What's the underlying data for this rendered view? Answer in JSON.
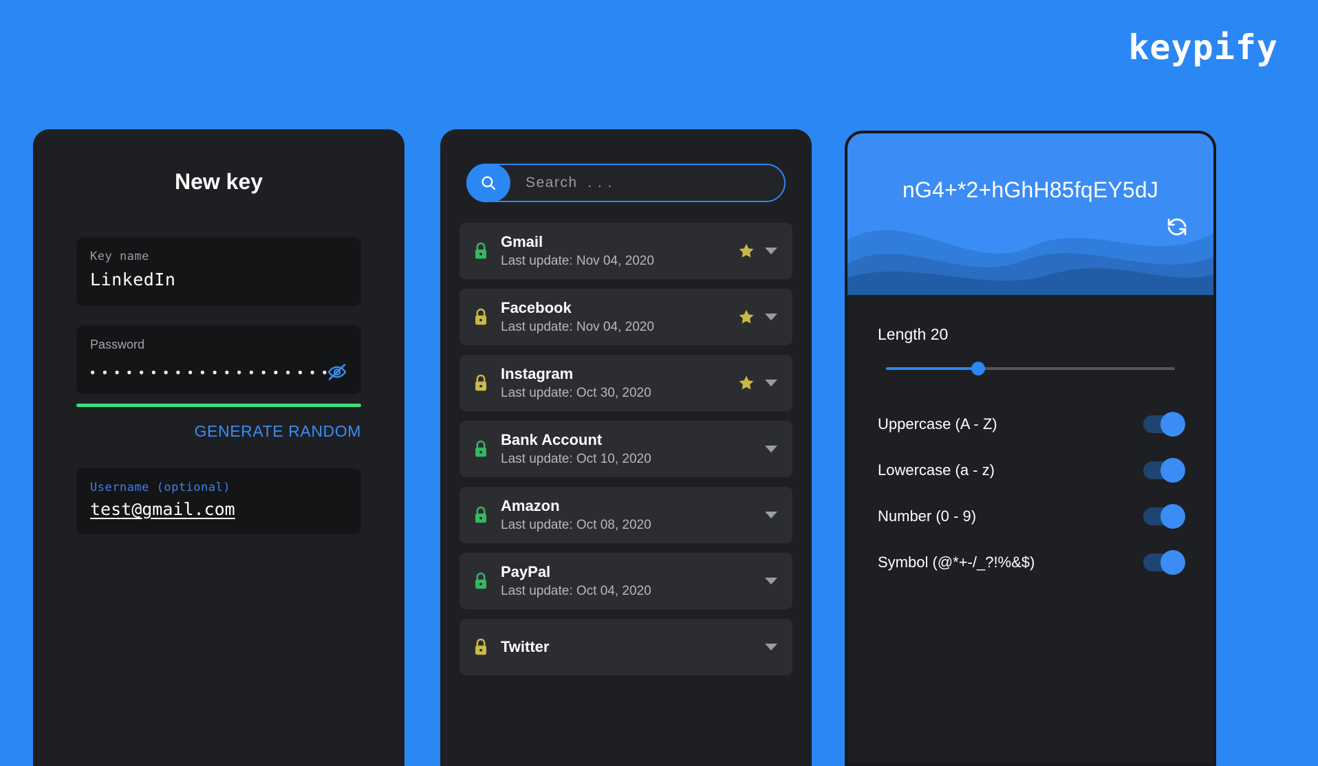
{
  "brand": {
    "name": "keypify"
  },
  "colors": {
    "background": "#2b87f3",
    "card": "#1e1f22",
    "accent_blue": "#3b8df5",
    "strength_green": "#3ae07c",
    "lock_green": "#35b863",
    "lock_yellow": "#c9ba45",
    "star_gold": "#c9ba45"
  },
  "new_key": {
    "title": "New key",
    "key_name": {
      "label": "Key name",
      "value": "LinkedIn"
    },
    "password": {
      "label": "Password",
      "masked_value": "••••••••••••••••••••",
      "visibility_icon": "eye-off-icon",
      "strength": "strong"
    },
    "generate_label": "GENERATE RANDOM",
    "username": {
      "label": "Username (optional)",
      "value": "test@gmail.com"
    }
  },
  "key_list": {
    "search": {
      "placeholder": "Search  . . .",
      "value": "",
      "icon": "search-icon"
    },
    "items": [
      {
        "name": "Gmail",
        "subtitle": "Last update: Nov 04, 2020",
        "lock": "green",
        "starred": true
      },
      {
        "name": "Facebook",
        "subtitle": "Last update: Nov 04, 2020",
        "lock": "yellow",
        "starred": true
      },
      {
        "name": "Instagram",
        "subtitle": "Last update: Oct 30, 2020",
        "lock": "yellow",
        "starred": true
      },
      {
        "name": "Bank Account",
        "subtitle": "Last update: Oct 10, 2020",
        "lock": "green",
        "starred": false
      },
      {
        "name": "Amazon",
        "subtitle": "Last update: Oct 08, 2020",
        "lock": "green",
        "starred": false
      },
      {
        "name": "PayPal",
        "subtitle": "Last update: Oct 04, 2020",
        "lock": "green",
        "starred": false
      },
      {
        "name": "Twitter",
        "subtitle": "",
        "lock": "yellow",
        "starred": false
      }
    ]
  },
  "generator": {
    "generated_password": "nG4+*2+hGhH85fqEY5dJ",
    "refresh_icon": "refresh-icon",
    "length_label": "Length 20",
    "length_value": 20,
    "slider_percent": 32,
    "options": [
      {
        "label": "Uppercase (A - Z)",
        "enabled": true
      },
      {
        "label": "Lowercase (a - z)",
        "enabled": true
      },
      {
        "label": "Number (0 - 9)",
        "enabled": true
      },
      {
        "label": "Symbol  (@*+-/_?!%&$)",
        "enabled": true
      }
    ]
  }
}
